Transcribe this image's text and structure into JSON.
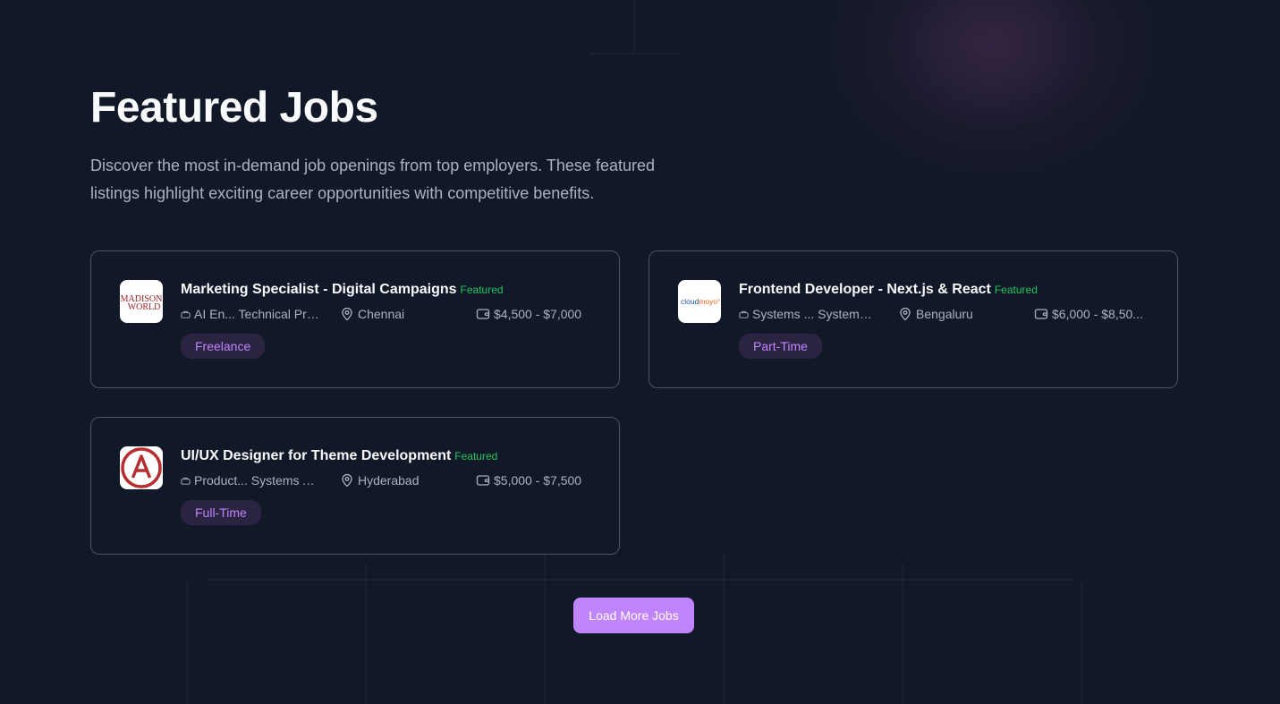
{
  "section": {
    "title": "Featured Jobs",
    "subtitle": "Discover the most in-demand job openings from top employers. These featured listings highlight exciting career opportunities with competitive benefits."
  },
  "jobs": [
    {
      "title": "Marketing Specialist - Digital Campaigns",
      "featured_label": "Featured",
      "company": "AI En... Technical Pro...",
      "location": "Chennai",
      "salary": "$4,500 - $7,000",
      "type": "Freelance",
      "logo": {
        "name": "madison-world-logo",
        "line1": "MADISON",
        "line2": "WORLD",
        "color": "#9b2226"
      }
    },
    {
      "title": "Frontend Developer - Next.js & React",
      "featured_label": "Featured",
      "company": "Systems ... Systems ...",
      "location": "Bengaluru",
      "salary": "$6,000 - $8,50...",
      "type": "Part-Time",
      "logo": {
        "name": "cloudmoyo-logo",
        "part1": "cloud",
        "part2": "moyo",
        "mark": "®",
        "color1": "#1d4f91",
        "color2": "#f26722"
      }
    },
    {
      "title": "UI/UX Designer for Theme Development",
      "featured_label": "Featured",
      "company": "Product... Systems A...",
      "location": "Hyderabad",
      "salary": "$5,000 - $7,500",
      "type": "Full-Time",
      "logo": {
        "name": "angular-logo",
        "letter": "A",
        "color": "#b52e31"
      }
    }
  ],
  "actions": {
    "load_more": "Load More Jobs"
  },
  "colors": {
    "background": "#111827",
    "accent": "#c084fc",
    "featured": "#22c55e",
    "badge_bg": "#2a2440",
    "border": "#4b5563"
  }
}
